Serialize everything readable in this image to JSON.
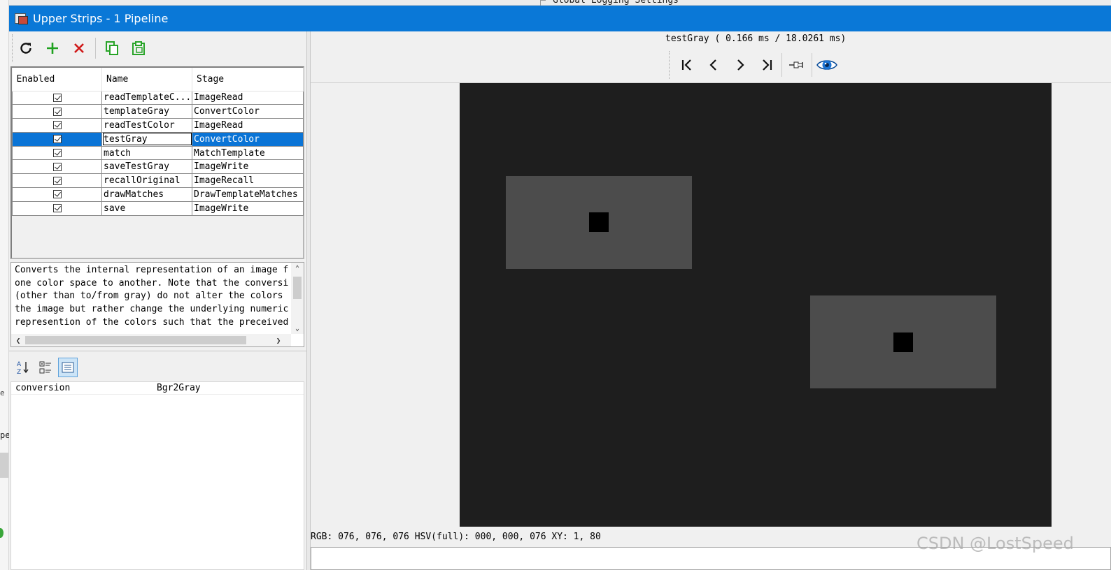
{
  "background": {
    "top_text": "Global Logging Settings",
    "left_text_1": "e",
    "left_text_2": "pe"
  },
  "window": {
    "title": "Upper Strips - 1 Pipeline",
    "titlebar_color": "#0a78d7"
  },
  "toolbar": {
    "icons": [
      "refresh-icon",
      "add-icon",
      "delete-icon",
      "copy-icon",
      "paste-icon"
    ]
  },
  "pipeline": {
    "columns": [
      "Enabled",
      "Name",
      "Stage"
    ],
    "rows": [
      {
        "enabled": true,
        "name": "readTemplateC...",
        "stage": "ImageRead"
      },
      {
        "enabled": true,
        "name": "templateGray",
        "stage": "ConvertColor"
      },
      {
        "enabled": true,
        "name": "readTestColor",
        "stage": "ImageRead"
      },
      {
        "enabled": true,
        "name": "testGray",
        "stage": "ConvertColor",
        "selected": true
      },
      {
        "enabled": true,
        "name": "match",
        "stage": "MatchTemplate"
      },
      {
        "enabled": true,
        "name": "saveTestGray",
        "stage": "ImageWrite"
      },
      {
        "enabled": true,
        "name": "recallOriginal",
        "stage": "ImageRecall"
      },
      {
        "enabled": true,
        "name": "drawMatches",
        "stage": "DrawTemplateMatches"
      },
      {
        "enabled": true,
        "name": "save",
        "stage": "ImageWrite"
      }
    ],
    "selection_color": "#0a74d6"
  },
  "description": {
    "lines": [
      "Converts the internal representation of an image f",
      "one color space to another. Note that the conversi",
      "(other than to/from gray) do not alter the colors",
      "the image but rather change the underlying numeric",
      "represention of the colors such that the preceived"
    ]
  },
  "properties": {
    "toolbar_icons": [
      "sort-alphabetical-icon",
      "categorized-icon",
      "property-pages-icon"
    ],
    "rows": [
      {
        "name": "conversion",
        "value": "Bgr2Gray"
      }
    ]
  },
  "viewer": {
    "title": "testGray ( 0.166 ms / 18.0261 ms)",
    "nav_icons": [
      "first-icon",
      "previous-icon",
      "next-icon",
      "last-icon",
      "pin-icon",
      "eye-icon"
    ],
    "status": "RGB: 076, 076, 076 HSV(full): 000, 000, 076 XY: 1, 80",
    "canvas_color": "#1e1e1e",
    "rect_color": "#4c4c4c"
  },
  "watermark": "CSDN @LostSpeed"
}
